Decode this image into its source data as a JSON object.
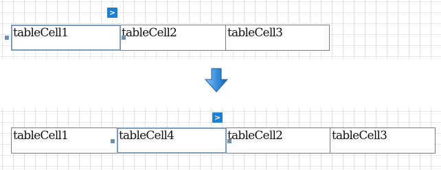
{
  "before": {
    "smart_tag_icon": "chevron-right-icon",
    "cells": [
      "tableCell1",
      "tableCell2",
      "tableCell3"
    ]
  },
  "transition_icon": "down-arrow-icon",
  "after": {
    "smart_tag_icon": "chevron-right-icon",
    "cells": [
      "tableCell1",
      "tableCell4",
      "tableCell2",
      "tableCell3"
    ]
  },
  "colors": {
    "selection_border": "#7f9ab8",
    "smart_tag": "#1f7fd0",
    "arrow": "#2f86d6",
    "grid": "#e3e6ea"
  }
}
